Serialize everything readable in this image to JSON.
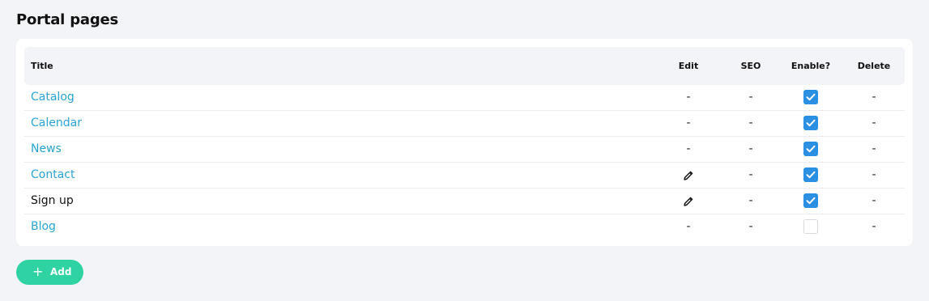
{
  "page": {
    "title": "Portal pages"
  },
  "table": {
    "headers": {
      "title": "Title",
      "edit": "Edit",
      "seo": "SEO",
      "enable": "Enable?",
      "delete": "Delete"
    },
    "rows": [
      {
        "title": "Catalog",
        "is_link": true,
        "edit": "-",
        "edit_icon": "",
        "seo": "-",
        "enabled": true,
        "delete": "-"
      },
      {
        "title": "Calendar",
        "is_link": true,
        "edit": "-",
        "edit_icon": "",
        "seo": "-",
        "enabled": true,
        "delete": "-"
      },
      {
        "title": "News",
        "is_link": true,
        "edit": "-",
        "edit_icon": "",
        "seo": "-",
        "enabled": true,
        "delete": "-"
      },
      {
        "title": "Contact",
        "is_link": true,
        "edit": "",
        "edit_icon": "pencil-icon",
        "seo": "-",
        "enabled": true,
        "delete": "-"
      },
      {
        "title": "Sign up",
        "is_link": false,
        "edit": "",
        "edit_icon": "pencil-icon",
        "seo": "-",
        "enabled": true,
        "delete": "-"
      },
      {
        "title": "Blog",
        "is_link": true,
        "edit": "-",
        "edit_icon": "",
        "seo": "-",
        "enabled": false,
        "delete": "-"
      }
    ]
  },
  "actions": {
    "add_label": "Add",
    "add_icon": "plus-icon"
  },
  "colors": {
    "link": "#2aa3d4",
    "checkbox_checked": "#2b8fe3",
    "add_button": "#2fd3a3",
    "background": "#f3f4f8"
  }
}
